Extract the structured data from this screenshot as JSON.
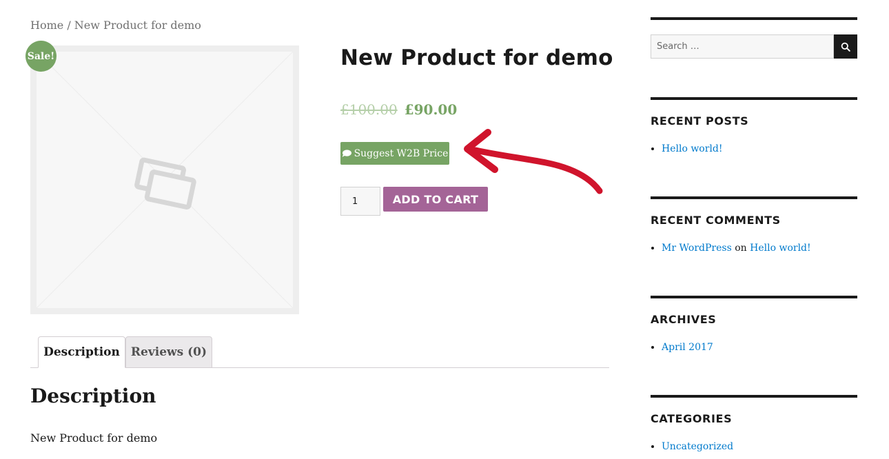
{
  "breadcrumb": {
    "home": "Home",
    "separator": " / ",
    "current": "New Product for demo"
  },
  "product": {
    "sale_badge": "Sale!",
    "title": "New Product for demo",
    "price_old": "£100.00",
    "price_new": "£90.00",
    "suggest_button": "Suggest W2B Price",
    "quantity": "1",
    "add_to_cart": "ADD TO CART"
  },
  "tabs": [
    {
      "label": "Description",
      "active": true
    },
    {
      "label": "Reviews (0)",
      "active": false
    }
  ],
  "description": {
    "heading": "Description",
    "text": "New Product for demo"
  },
  "sidebar": {
    "search_placeholder": "Search …",
    "recent_posts": {
      "title": "RECENT POSTS",
      "items": [
        "Hello world!"
      ]
    },
    "recent_comments": {
      "title": "RECENT COMMENTS",
      "author": "Mr WordPress",
      "connector": "on",
      "post": "Hello world!"
    },
    "archives": {
      "title": "ARCHIVES",
      "items": [
        "April 2017"
      ]
    },
    "categories": {
      "title": "CATEGORIES",
      "items": [
        "Uncategorized"
      ]
    }
  },
  "colors": {
    "accent_green": "#77a464",
    "accent_purple": "#a46497",
    "link_blue": "#007acc",
    "annotation_red": "#d0142c"
  },
  "icons": [
    "image-placeholder-icon",
    "chat-bubble-icon",
    "search-icon",
    "annotation-arrow-icon"
  ]
}
